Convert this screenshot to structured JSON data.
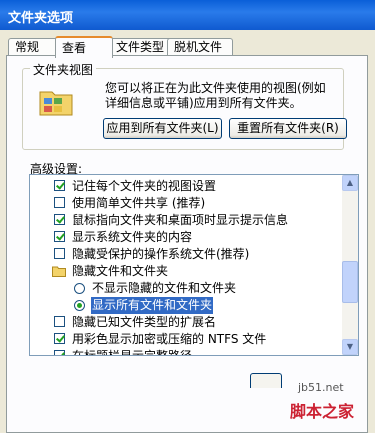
{
  "window": {
    "title": "文件夹选项"
  },
  "tabs": [
    {
      "label": "常规"
    },
    {
      "label": "查看"
    },
    {
      "label": "文件类型"
    },
    {
      "label": "脱机文件"
    }
  ],
  "folder_views": {
    "group_label": "文件夹视图",
    "description": "您可以将正在为此文件夹使用的视图(例如详细信息或平铺)应用到所有文件夹。",
    "apply_button": "应用到所有文件夹(L)",
    "reset_button": "重置所有文件夹(R)"
  },
  "advanced": {
    "label": "高级设置:",
    "items": [
      {
        "type": "checkbox",
        "checked": true,
        "label": "记住每个文件夹的视图设置"
      },
      {
        "type": "checkbox",
        "checked": false,
        "label": "使用简单文件共享 (推荐)"
      },
      {
        "type": "checkbox",
        "checked": true,
        "label": "鼠标指向文件夹和桌面项时显示提示信息"
      },
      {
        "type": "checkbox",
        "checked": true,
        "label": "显示系统文件夹的内容"
      },
      {
        "type": "checkbox",
        "checked": false,
        "label": "隐藏受保护的操作系统文件(推荐)"
      },
      {
        "type": "folder",
        "label": "隐藏文件和文件夹"
      },
      {
        "type": "radio",
        "checked": false,
        "label": "不显示隐藏的文件和文件夹"
      },
      {
        "type": "radio",
        "checked": true,
        "label": "显示所有文件和文件夹"
      },
      {
        "type": "checkbox",
        "checked": false,
        "label": "隐藏已知文件类型的扩展名"
      },
      {
        "type": "checkbox",
        "checked": true,
        "label": "用彩色显示加密或压缩的 NTFS 文件"
      },
      {
        "type": "checkbox",
        "checked": true,
        "label": "在标题栏显示完整路径"
      }
    ]
  },
  "watermark": {
    "url": "jb51.net",
    "name": "脚本之家"
  }
}
